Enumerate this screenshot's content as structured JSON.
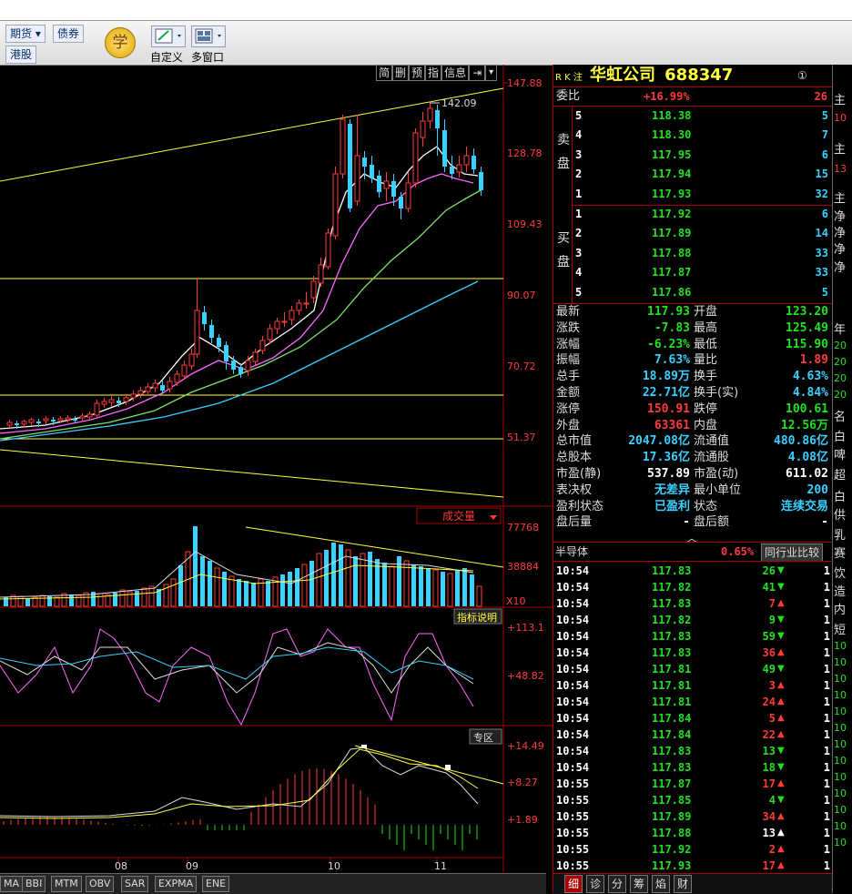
{
  "toolbar": {
    "futures": "期货",
    "bonds": "债券",
    "hk": "港股",
    "learn": "学",
    "customize": "自定义",
    "multiwindow": "多窗口"
  },
  "chart_tools": [
    "简",
    "删",
    "预",
    "指",
    "信息"
  ],
  "chart_data": {
    "type": "candlestick",
    "price_axis": [
      "147.88",
      "128.78",
      "109.43",
      "90.07",
      "70.72",
      "51.37"
    ],
    "high_label": "142.09",
    "volume_axis": [
      "77768",
      "38884"
    ],
    "volume_unit": "X10",
    "volume_selector": "成交量",
    "indicator1_axis": [
      "+113.1",
      "+48.82"
    ],
    "indicator1_button": "指标说明",
    "indicator2_axis": [
      "+14.49",
      "+8.27",
      "+1.89"
    ],
    "indicator2_button": "专区",
    "months": [
      "08",
      "09",
      "10",
      "11"
    ]
  },
  "indicator_tabs": [
    "MA",
    "BBI",
    "MTM",
    "OBV",
    "SAR",
    "EXPMA",
    "ENE"
  ],
  "stock": {
    "tags": "R K 注",
    "name": "华虹公司",
    "code": "688347",
    "info_icon": "①"
  },
  "weibi": {
    "label": "委比",
    "value": "+16.99%",
    "diff": "26"
  },
  "sell_label": [
    "卖",
    "盘"
  ],
  "buy_label": [
    "买",
    "盘"
  ],
  "sell": [
    {
      "level": "5",
      "price": "118.38",
      "vol": "5"
    },
    {
      "level": "4",
      "price": "118.30",
      "vol": "7"
    },
    {
      "level": "3",
      "price": "117.95",
      "vol": "6"
    },
    {
      "level": "2",
      "price": "117.94",
      "vol": "15"
    },
    {
      "level": "1",
      "price": "117.93",
      "vol": "32"
    }
  ],
  "buy": [
    {
      "level": "1",
      "price": "117.92",
      "vol": "6"
    },
    {
      "level": "2",
      "price": "117.89",
      "vol": "14"
    },
    {
      "level": "3",
      "price": "117.88",
      "vol": "33"
    },
    {
      "level": "4",
      "price": "117.87",
      "vol": "33"
    },
    {
      "level": "5",
      "price": "117.86",
      "vol": "5"
    }
  ],
  "stats": [
    {
      "l1": "最新",
      "v1": "117.93",
      "c1": "grn",
      "l2": "开盘",
      "v2": "123.20",
      "c2": "grn"
    },
    {
      "l1": "涨跌",
      "v1": "-7.83",
      "c1": "grn",
      "l2": "最高",
      "v2": "125.49",
      "c2": "grn"
    },
    {
      "l1": "涨幅",
      "v1": "-6.23%",
      "c1": "grn",
      "l2": "最低",
      "v2": "115.90",
      "c2": "grn"
    },
    {
      "l1": "振幅",
      "v1": "7.63%",
      "c1": "cya",
      "l2": "量比",
      "v2": "1.89",
      "c2": "red"
    },
    {
      "l1": "总手",
      "v1": "18.89万",
      "c1": "cya",
      "l2": "换手",
      "v2": "4.63%",
      "c2": "cya"
    },
    {
      "l1": "金额",
      "v1": "22.71亿",
      "c1": "cya",
      "l2": "换手(实)",
      "v2": "4.84%",
      "c2": "cya"
    },
    {
      "l1": "涨停",
      "v1": "150.91",
      "c1": "red",
      "l2": "跌停",
      "v2": "100.61",
      "c2": "grn"
    },
    {
      "l1": "外盘",
      "v1": "63361",
      "c1": "red",
      "l2": "内盘",
      "v2": "12.56万",
      "c2": "grn"
    },
    {
      "l1": "总市值",
      "v1": "2047.08亿",
      "c1": "cya",
      "l2": "流通值",
      "v2": "480.86亿",
      "c2": "cya"
    },
    {
      "l1": "总股本",
      "v1": "17.36亿",
      "c1": "cya",
      "l2": "流通股",
      "v2": "4.08亿",
      "c2": "cya"
    },
    {
      "l1": "市盈(静)",
      "v1": "537.89",
      "c1": "wht",
      "l2": "市盈(动)",
      "v2": "611.02",
      "c2": "wht"
    },
    {
      "l1": "表决权",
      "v1": "无差异",
      "c1": "cya",
      "l2": "最小单位",
      "v2": "200",
      "c2": "cya"
    },
    {
      "l1": "盈利状态",
      "v1": "已盈利",
      "c1": "cya",
      "l2": "状态",
      "v2": "连续交易",
      "c2": "cya"
    },
    {
      "l1": "盘后量",
      "v1": "-",
      "c1": "wht",
      "l2": "盘后额",
      "v2": "-",
      "c2": "wht"
    }
  ],
  "industry": {
    "name": "半导体",
    "change": "0.65%",
    "button": "同行业比较"
  },
  "ticks": [
    {
      "t": "10:54",
      "p": "117.83",
      "v": "26",
      "d": "down"
    },
    {
      "t": "10:54",
      "p": "117.82",
      "v": "41",
      "d": "down"
    },
    {
      "t": "10:54",
      "p": "117.83",
      "v": "7",
      "d": "up"
    },
    {
      "t": "10:54",
      "p": "117.82",
      "v": "9",
      "d": "down"
    },
    {
      "t": "10:54",
      "p": "117.83",
      "v": "59",
      "d": "down"
    },
    {
      "t": "10:54",
      "p": "117.83",
      "v": "36",
      "d": "up"
    },
    {
      "t": "10:54",
      "p": "117.81",
      "v": "49",
      "d": "down"
    },
    {
      "t": "10:54",
      "p": "117.81",
      "v": "3",
      "d": "up"
    },
    {
      "t": "10:54",
      "p": "117.81",
      "v": "24",
      "d": "up"
    },
    {
      "t": "10:54",
      "p": "117.84",
      "v": "5",
      "d": "up"
    },
    {
      "t": "10:54",
      "p": "117.84",
      "v": "22",
      "d": "up"
    },
    {
      "t": "10:54",
      "p": "117.83",
      "v": "13",
      "d": "down"
    },
    {
      "t": "10:54",
      "p": "117.83",
      "v": "18",
      "d": "down"
    },
    {
      "t": "10:55",
      "p": "117.87",
      "v": "17",
      "d": "up"
    },
    {
      "t": "10:55",
      "p": "117.85",
      "v": "4",
      "d": "down"
    },
    {
      "t": "10:55",
      "p": "117.89",
      "v": "34",
      "d": "up"
    },
    {
      "t": "10:55",
      "p": "117.88",
      "v": "13",
      "d": "neutral"
    },
    {
      "t": "10:55",
      "p": "117.92",
      "v": "2",
      "d": "up"
    },
    {
      "t": "10:55",
      "p": "117.93",
      "v": "17",
      "d": "up"
    }
  ],
  "tick_tail": "1",
  "panel_tabs": [
    "细",
    "诊",
    "分",
    "筹",
    "焰",
    "财"
  ],
  "farright": [
    "主",
    "10",
    "主",
    "13",
    "主",
    "净",
    "净",
    "净",
    "净",
    "年",
    "20",
    "20",
    "20",
    "20",
    "名",
    "白",
    "啤",
    "超",
    "白",
    "供",
    "乳",
    "赛",
    "饮",
    "造",
    "内",
    "短",
    "10",
    "10",
    "10",
    "10",
    "10",
    "10",
    "10",
    "10",
    "10",
    "10",
    "10",
    "10",
    "10"
  ],
  "colors": {
    "up": "#ff3b3b",
    "down": "#21e021",
    "bear_candle": "#3ad0ff",
    "grid": "#a00000"
  }
}
